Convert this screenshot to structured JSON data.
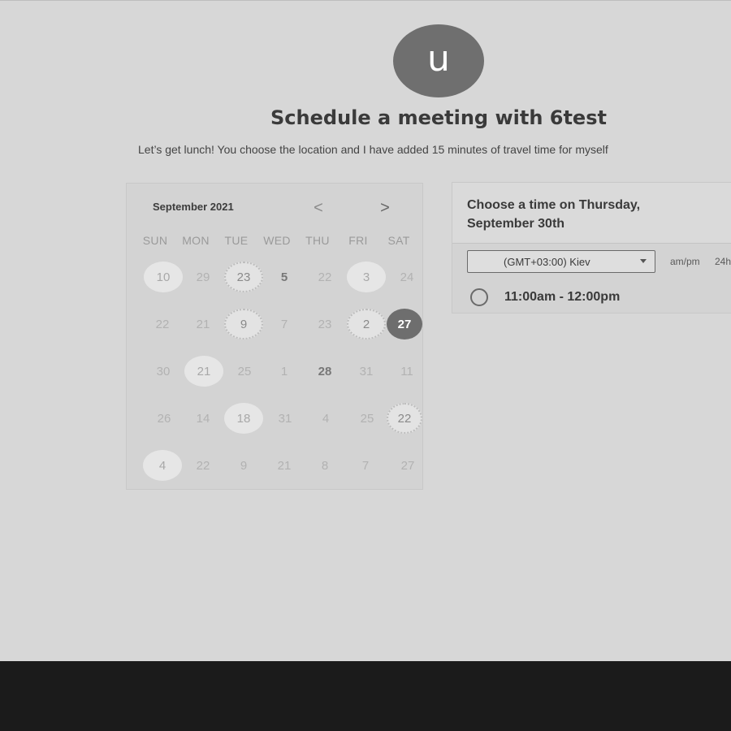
{
  "header": {
    "avatar_letter": "u",
    "title": "Schedule a meeting with 6test",
    "subtitle": "Let’s get lunch! You choose the location and I have added 15 minutes of travel time for myself"
  },
  "calendar": {
    "month_label": "September 2021",
    "prev_symbol": "<",
    "next_symbol": ">",
    "weekdays": [
      "SUN",
      "MON",
      "TUE",
      "WED",
      "THU",
      "FRI",
      "SAT"
    ],
    "selected_day": "27",
    "weeks": [
      [
        "10",
        "29",
        "23",
        "5",
        "22",
        "3",
        "24"
      ],
      [
        "22",
        "21",
        "9",
        "7",
        "23",
        "2",
        "27"
      ],
      [
        "30",
        "21",
        "25",
        "1",
        "28",
        "31",
        "11"
      ],
      [
        "26",
        "14",
        "18",
        "31",
        "4",
        "25",
        "22"
      ],
      [
        "4",
        "22",
        "9",
        "21",
        "8",
        "7",
        "27"
      ]
    ]
  },
  "time_panel": {
    "heading": "Choose a time on Thursday, September 30th",
    "timezone": "(GMT+03:00) Kiev",
    "format_ampm": "am/pm",
    "format_24h": "24h",
    "slots": [
      "11:00am - 12:00pm"
    ]
  }
}
